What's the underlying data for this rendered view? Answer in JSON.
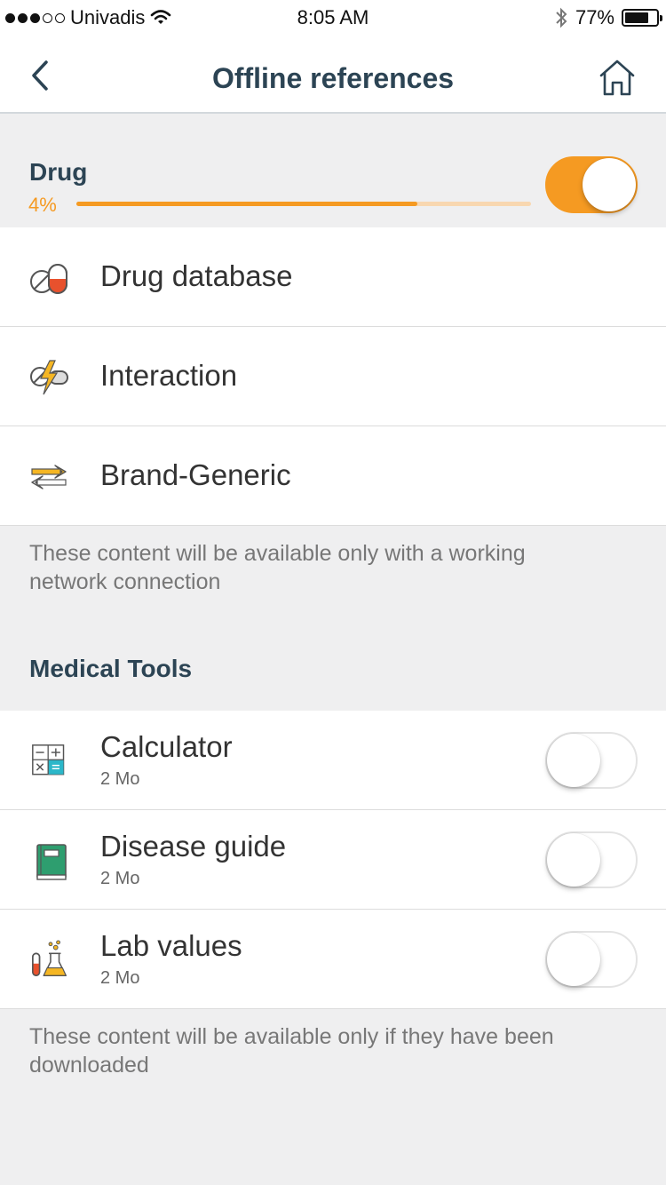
{
  "status_bar": {
    "carrier": "Univadis",
    "time": "8:05 AM",
    "battery_percent": "77%",
    "battery_level": 0.77
  },
  "nav": {
    "title": "Offline references",
    "back_icon": "chevron-left-icon",
    "home_icon": "home-icon"
  },
  "drug_section": {
    "title": "Drug",
    "progress_text": "4%",
    "progress_fill": 0.75,
    "toggle_on": true,
    "items": [
      {
        "label": "Drug database",
        "icon": "pill-capsule-icon"
      },
      {
        "label": "Interaction",
        "icon": "pill-lightning-icon"
      },
      {
        "label": "Brand-Generic",
        "icon": "swap-arrows-icon"
      }
    ],
    "note": "These content will be available only with a working network connection"
  },
  "medical_tools": {
    "title": "Medical Tools",
    "items": [
      {
        "label": "Calculator",
        "size": "2 Mo",
        "icon": "calculator-icon",
        "toggle_on": false
      },
      {
        "label": "Disease guide",
        "size": "2 Mo",
        "icon": "book-icon",
        "toggle_on": false
      },
      {
        "label": "Lab values",
        "size": "2 Mo",
        "icon": "lab-flask-icon",
        "toggle_on": false
      }
    ],
    "note": "These content will be available only if they have been downloaded"
  },
  "colors": {
    "accent": "#f59a22",
    "heading": "#2c4454",
    "background": "#efeff0"
  }
}
